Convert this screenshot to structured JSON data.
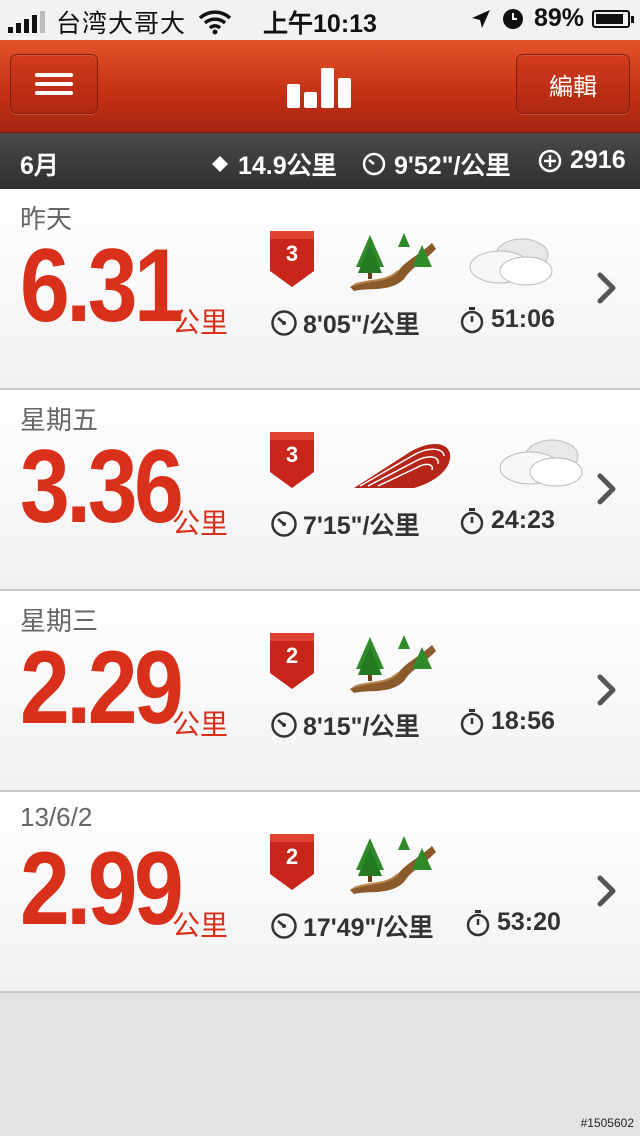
{
  "status_bar": {
    "carrier": "台湾大哥大",
    "time": "上午10:13",
    "battery_percent": "89%",
    "battery_level": 0.89,
    "icons": [
      "signal-icon",
      "wifi-icon",
      "location-icon",
      "clock-icon",
      "battery-icon"
    ]
  },
  "nav": {
    "menu_icon": "hamburger-menu-icon",
    "logo_icon": "bar-chart-logo-icon",
    "edit_label": "編輯"
  },
  "summary": {
    "month": "6月",
    "total_distance": "14.9公里",
    "avg_pace": "9'52\"/公里",
    "calories": "2916"
  },
  "runs": [
    {
      "date": "昨天",
      "distance": "6.31",
      "unit": "公里",
      "badge": "3",
      "terrain": "trail",
      "weather": "cloudy",
      "pace": "8'05\"/公里",
      "duration": "51:06"
    },
    {
      "date": "星期五",
      "distance": "3.36",
      "unit": "公里",
      "badge": "3",
      "terrain": "track",
      "weather": "cloudy",
      "pace": "7'15\"/公里",
      "duration": "24:23"
    },
    {
      "date": "星期三",
      "distance": "2.29",
      "unit": "公里",
      "badge": "2",
      "terrain": "trail",
      "weather": "",
      "pace": "8'15\"/公里",
      "duration": "18:56"
    },
    {
      "date": "13/6/2",
      "distance": "2.99",
      "unit": "公里",
      "badge": "2",
      "terrain": "trail",
      "weather": "",
      "pace": "17'49\"/公里",
      "duration": "53:20"
    }
  ],
  "watermark": "#1505602",
  "colors": {
    "accent": "#d8301b",
    "nav": "#c63215",
    "summary_bg": "#2f2f2f"
  }
}
